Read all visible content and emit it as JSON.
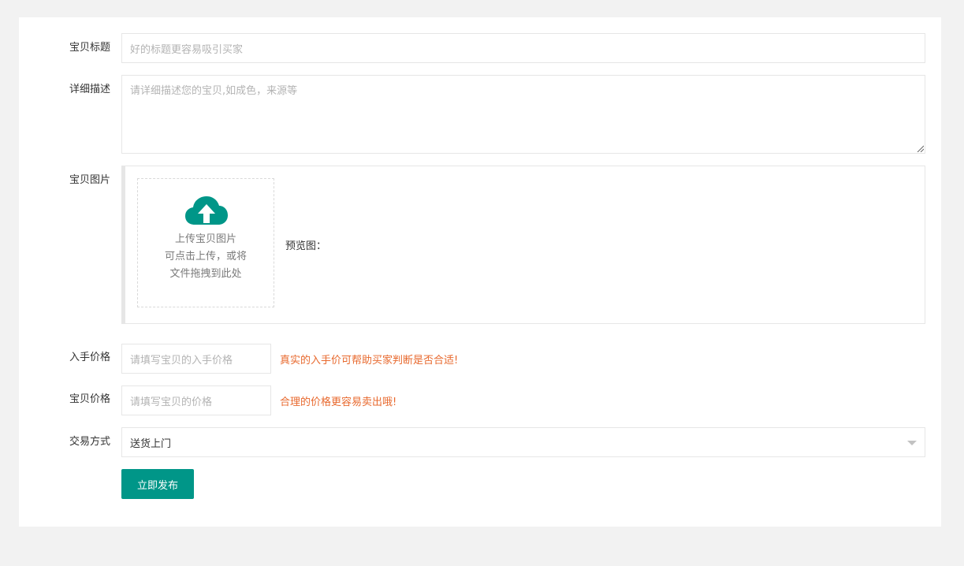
{
  "form": {
    "title": {
      "label": "宝贝标题",
      "placeholder": "好的标题更容易吸引买家"
    },
    "description": {
      "label": "详细描述",
      "placeholder": "请详细描述您的宝贝,如成色，来源等"
    },
    "images": {
      "label": "宝贝图片",
      "upload_line1": "上传宝贝图片",
      "upload_line2": "可点击上传，或将",
      "upload_line3": "文件拖拽到此处",
      "preview_label": "预览图："
    },
    "purchase_price": {
      "label": "入手价格",
      "placeholder": "请填写宝贝的入手价格",
      "hint": "真实的入手价可帮助买家判断是否合适!"
    },
    "price": {
      "label": "宝贝价格",
      "placeholder": "请填写宝贝的价格",
      "hint": "合理的价格更容易卖出哦!"
    },
    "trade_method": {
      "label": "交易方式",
      "value": "送货上门"
    },
    "submit_label": "立即发布"
  },
  "colors": {
    "accent": "#009688",
    "hint": "#e8692e",
    "background": "#f2f2f2"
  },
  "icons": {
    "upload": "cloud-upload-icon",
    "dropdown": "caret-down-icon",
    "resize": "resize-handle-icon"
  }
}
